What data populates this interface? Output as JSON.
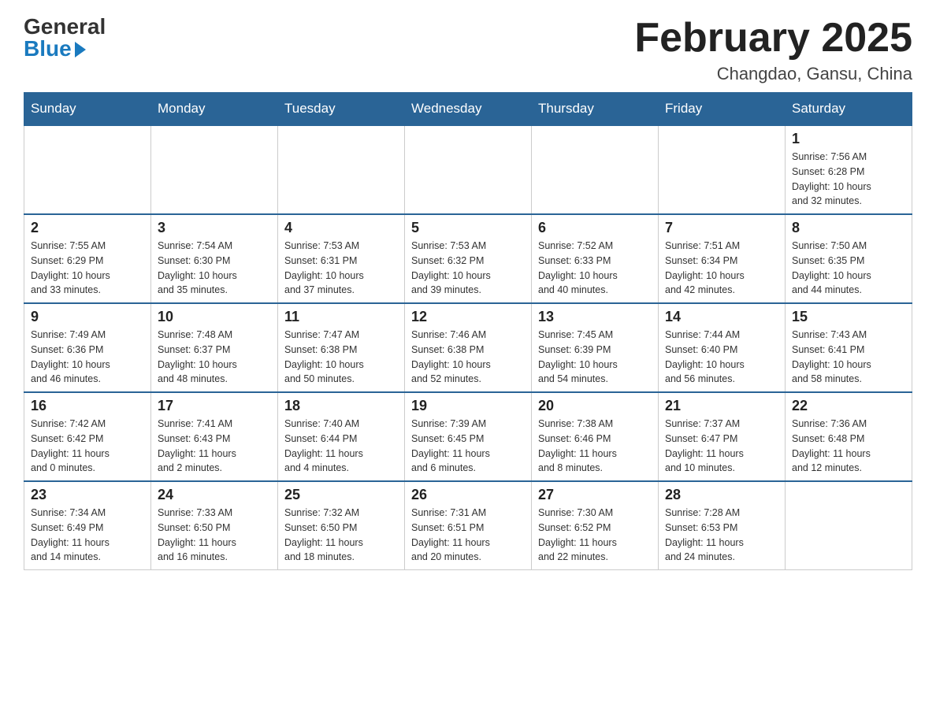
{
  "header": {
    "logo": {
      "general": "General",
      "blue": "Blue"
    },
    "title": "February 2025",
    "location": "Changdao, Gansu, China"
  },
  "days_of_week": [
    "Sunday",
    "Monday",
    "Tuesday",
    "Wednesday",
    "Thursday",
    "Friday",
    "Saturday"
  ],
  "weeks": [
    [
      {
        "day": "",
        "info": ""
      },
      {
        "day": "",
        "info": ""
      },
      {
        "day": "",
        "info": ""
      },
      {
        "day": "",
        "info": ""
      },
      {
        "day": "",
        "info": ""
      },
      {
        "day": "",
        "info": ""
      },
      {
        "day": "1",
        "info": "Sunrise: 7:56 AM\nSunset: 6:28 PM\nDaylight: 10 hours\nand 32 minutes."
      }
    ],
    [
      {
        "day": "2",
        "info": "Sunrise: 7:55 AM\nSunset: 6:29 PM\nDaylight: 10 hours\nand 33 minutes."
      },
      {
        "day": "3",
        "info": "Sunrise: 7:54 AM\nSunset: 6:30 PM\nDaylight: 10 hours\nand 35 minutes."
      },
      {
        "day": "4",
        "info": "Sunrise: 7:53 AM\nSunset: 6:31 PM\nDaylight: 10 hours\nand 37 minutes."
      },
      {
        "day": "5",
        "info": "Sunrise: 7:53 AM\nSunset: 6:32 PM\nDaylight: 10 hours\nand 39 minutes."
      },
      {
        "day": "6",
        "info": "Sunrise: 7:52 AM\nSunset: 6:33 PM\nDaylight: 10 hours\nand 40 minutes."
      },
      {
        "day": "7",
        "info": "Sunrise: 7:51 AM\nSunset: 6:34 PM\nDaylight: 10 hours\nand 42 minutes."
      },
      {
        "day": "8",
        "info": "Sunrise: 7:50 AM\nSunset: 6:35 PM\nDaylight: 10 hours\nand 44 minutes."
      }
    ],
    [
      {
        "day": "9",
        "info": "Sunrise: 7:49 AM\nSunset: 6:36 PM\nDaylight: 10 hours\nand 46 minutes."
      },
      {
        "day": "10",
        "info": "Sunrise: 7:48 AM\nSunset: 6:37 PM\nDaylight: 10 hours\nand 48 minutes."
      },
      {
        "day": "11",
        "info": "Sunrise: 7:47 AM\nSunset: 6:38 PM\nDaylight: 10 hours\nand 50 minutes."
      },
      {
        "day": "12",
        "info": "Sunrise: 7:46 AM\nSunset: 6:38 PM\nDaylight: 10 hours\nand 52 minutes."
      },
      {
        "day": "13",
        "info": "Sunrise: 7:45 AM\nSunset: 6:39 PM\nDaylight: 10 hours\nand 54 minutes."
      },
      {
        "day": "14",
        "info": "Sunrise: 7:44 AM\nSunset: 6:40 PM\nDaylight: 10 hours\nand 56 minutes."
      },
      {
        "day": "15",
        "info": "Sunrise: 7:43 AM\nSunset: 6:41 PM\nDaylight: 10 hours\nand 58 minutes."
      }
    ],
    [
      {
        "day": "16",
        "info": "Sunrise: 7:42 AM\nSunset: 6:42 PM\nDaylight: 11 hours\nand 0 minutes."
      },
      {
        "day": "17",
        "info": "Sunrise: 7:41 AM\nSunset: 6:43 PM\nDaylight: 11 hours\nand 2 minutes."
      },
      {
        "day": "18",
        "info": "Sunrise: 7:40 AM\nSunset: 6:44 PM\nDaylight: 11 hours\nand 4 minutes."
      },
      {
        "day": "19",
        "info": "Sunrise: 7:39 AM\nSunset: 6:45 PM\nDaylight: 11 hours\nand 6 minutes."
      },
      {
        "day": "20",
        "info": "Sunrise: 7:38 AM\nSunset: 6:46 PM\nDaylight: 11 hours\nand 8 minutes."
      },
      {
        "day": "21",
        "info": "Sunrise: 7:37 AM\nSunset: 6:47 PM\nDaylight: 11 hours\nand 10 minutes."
      },
      {
        "day": "22",
        "info": "Sunrise: 7:36 AM\nSunset: 6:48 PM\nDaylight: 11 hours\nand 12 minutes."
      }
    ],
    [
      {
        "day": "23",
        "info": "Sunrise: 7:34 AM\nSunset: 6:49 PM\nDaylight: 11 hours\nand 14 minutes."
      },
      {
        "day": "24",
        "info": "Sunrise: 7:33 AM\nSunset: 6:50 PM\nDaylight: 11 hours\nand 16 minutes."
      },
      {
        "day": "25",
        "info": "Sunrise: 7:32 AM\nSunset: 6:50 PM\nDaylight: 11 hours\nand 18 minutes."
      },
      {
        "day": "26",
        "info": "Sunrise: 7:31 AM\nSunset: 6:51 PM\nDaylight: 11 hours\nand 20 minutes."
      },
      {
        "day": "27",
        "info": "Sunrise: 7:30 AM\nSunset: 6:52 PM\nDaylight: 11 hours\nand 22 minutes."
      },
      {
        "day": "28",
        "info": "Sunrise: 7:28 AM\nSunset: 6:53 PM\nDaylight: 11 hours\nand 24 minutes."
      },
      {
        "day": "",
        "info": ""
      }
    ]
  ]
}
